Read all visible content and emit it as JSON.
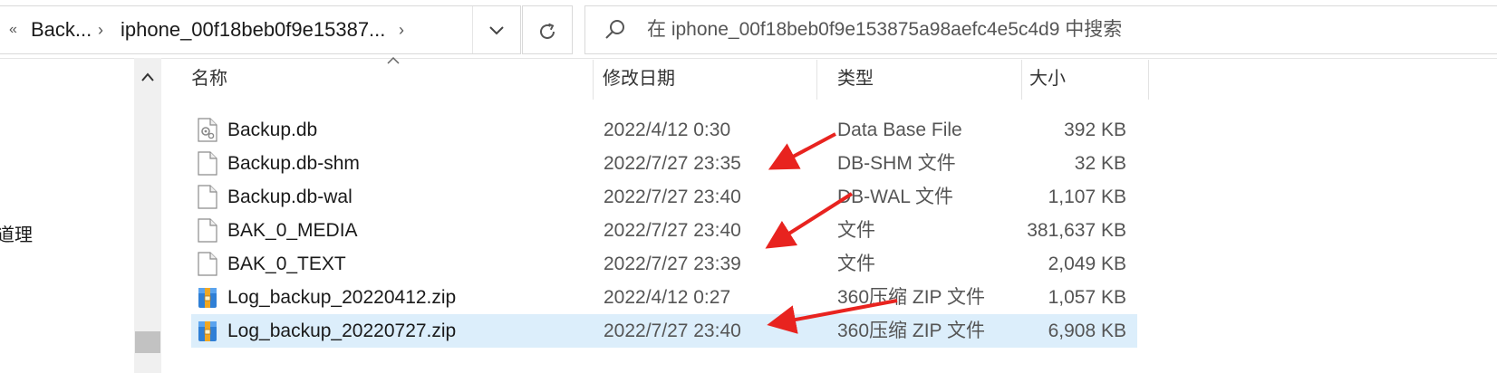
{
  "address_bar": {
    "back_chevron": "«",
    "crumbs": [
      "Back...",
      "iphone_00f18beb0f9e15387..."
    ],
    "separator": "›"
  },
  "search": {
    "placeholder": "在 iphone_00f18beb0f9e153875a98aefc4e5c4d9 中搜索"
  },
  "nav": {
    "partial_label": "道理"
  },
  "columns": {
    "name": "名称",
    "date": "修改日期",
    "type": "类型",
    "size": "大小"
  },
  "files": [
    {
      "name": "Backup.db",
      "date": "2022/4/12 0:30",
      "type": "Data Base File",
      "size": "392 KB",
      "icon": "db-file-icon"
    },
    {
      "name": "Backup.db-shm",
      "date": "2022/7/27 23:35",
      "type": "DB-SHM 文件",
      "size": "32 KB",
      "icon": "blank-file-icon"
    },
    {
      "name": "Backup.db-wal",
      "date": "2022/7/27 23:40",
      "type": "DB-WAL 文件",
      "size": "1,107 KB",
      "icon": "blank-file-icon"
    },
    {
      "name": "BAK_0_MEDIA",
      "date": "2022/7/27 23:40",
      "type": "文件",
      "size": "381,637 KB",
      "icon": "blank-file-icon"
    },
    {
      "name": "BAK_0_TEXT",
      "date": "2022/7/27 23:39",
      "type": "文件",
      "size": "2,049 KB",
      "icon": "blank-file-icon"
    },
    {
      "name": "Log_backup_20220412.zip",
      "date": "2022/4/12 0:27",
      "type": "360压缩 ZIP 文件",
      "size": "1,057 KB",
      "icon": "zip-archive-icon"
    },
    {
      "name": "Log_backup_20220727.zip",
      "date": "2022/7/27 23:40",
      "type": "360压缩 ZIP 文件",
      "size": "6,908 KB",
      "icon": "zip-archive-icon",
      "selected": true
    }
  ],
  "colors": {
    "selection": "#dceefb",
    "annotation_arrow": "#e8231f"
  }
}
